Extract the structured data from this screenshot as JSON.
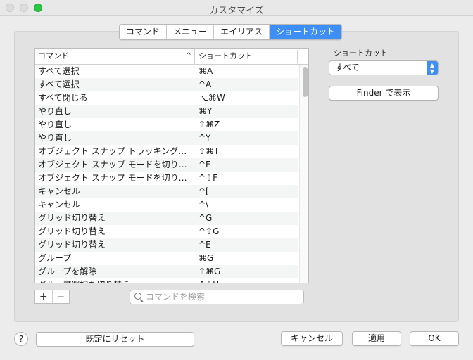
{
  "window": {
    "title": "カスタマイズ"
  },
  "tabs": [
    {
      "label": "コマンド",
      "active": false
    },
    {
      "label": "メニュー",
      "active": false
    },
    {
      "label": "エイリアス",
      "active": false
    },
    {
      "label": "ショートカット",
      "active": true
    }
  ],
  "table": {
    "columns": [
      "コマンド",
      "ショートカット"
    ],
    "sort_indicator": "^",
    "rows": [
      [
        "すべて選択",
        "⌘A"
      ],
      [
        "すべて選択",
        "^A"
      ],
      [
        "すべて閉じる",
        "⌥⌘W"
      ],
      [
        "やり直し",
        "⌘Y"
      ],
      [
        "やり直し",
        "⇧⌘Z"
      ],
      [
        "やり直し",
        "^Y"
      ],
      [
        "オブジェクト スナップ トラッキング…",
        "⇧⌘T"
      ],
      [
        "オブジェクト スナップ モードを切り…",
        "^F"
      ],
      [
        "オブジェクト スナップ モードを切り…",
        "^⇧F"
      ],
      [
        "キャンセル",
        "^["
      ],
      [
        "キャンセル",
        "^\\"
      ],
      [
        "グリッド切り替え",
        "^G"
      ],
      [
        "グリッド切り替え",
        "^⇧G"
      ],
      [
        "グリッド切り替え",
        "^E"
      ],
      [
        "グループ",
        "⌘G"
      ],
      [
        "グループを解除",
        "⇧⌘G"
      ],
      [
        "グループ選択を切り替え",
        "^⇧H"
      ]
    ]
  },
  "add_label": "+",
  "remove_label": "−",
  "search": {
    "placeholder": "コマンドを検索"
  },
  "filter": {
    "label": "ショートカット",
    "value": "すべて"
  },
  "finder_button": "Finder で表示",
  "help_label": "?",
  "reset_button": "既定にリセット",
  "cancel_button": "キャンセル",
  "apply_button": "適用",
  "ok_button": "OK",
  "colors": {
    "accent": "#3d8ef5",
    "zoom_button": "#28c840"
  }
}
